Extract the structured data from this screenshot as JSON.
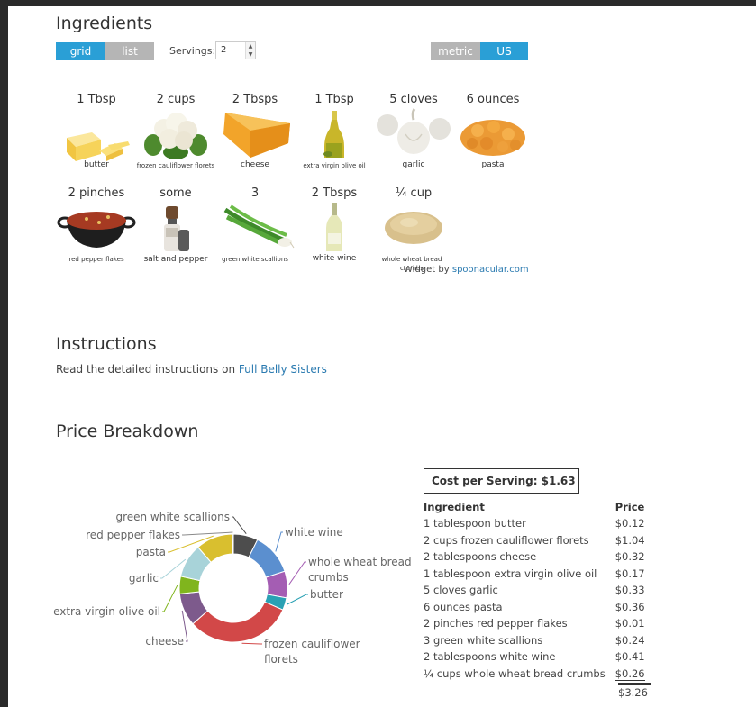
{
  "ingredients_section": {
    "title": "Ingredients",
    "view_toggle": {
      "grid": "grid",
      "list": "list",
      "active": "grid"
    },
    "servings_label": "Servings:",
    "servings_value": "2",
    "unit_toggle": {
      "metric": "metric",
      "us": "US",
      "active": "US"
    },
    "items": [
      {
        "amount": "1 Tbsp",
        "name": "butter",
        "icon": "butter"
      },
      {
        "amount": "2 cups",
        "name": "frozen cauliflower florets",
        "icon": "cauliflower"
      },
      {
        "amount": "2 Tbsps",
        "name": "cheese",
        "icon": "cheese"
      },
      {
        "amount": "1 Tbsp",
        "name": "extra virgin olive oil",
        "icon": "olive-oil"
      },
      {
        "amount": "5 cloves",
        "name": "garlic",
        "icon": "garlic"
      },
      {
        "amount": "6 ounces",
        "name": "pasta",
        "icon": "pasta"
      },
      {
        "amount": "2 pinches",
        "name": "red pepper flakes",
        "icon": "red-pepper-flakes"
      },
      {
        "amount": "some",
        "name": "salt and pepper",
        "icon": "salt-pepper"
      },
      {
        "amount": "3",
        "name": "green white scallions",
        "icon": "scallions"
      },
      {
        "amount": "2 Tbsps",
        "name": "white wine",
        "icon": "white-wine"
      },
      {
        "amount": "¼ cup",
        "name": "whole wheat bread crumbs",
        "icon": "bread-crumbs"
      }
    ],
    "widget_by": "Widget by",
    "widget_link": "spoonacular.com"
  },
  "instructions_section": {
    "title": "Instructions",
    "text": "Read the detailed instructions on",
    "link": "Full Belly Sisters"
  },
  "price_section": {
    "title": "Price Breakdown",
    "cost_per_serving": "Cost per Serving: $1.63",
    "table": {
      "header_ingredient": "Ingredient",
      "header_price": "Price",
      "rows": [
        {
          "ingredient": "1 tablespoon butter",
          "price": "$0.12"
        },
        {
          "ingredient": "2 cups frozen cauliflower florets",
          "price": "$1.04"
        },
        {
          "ingredient": "2 tablespoons cheese",
          "price": "$0.32"
        },
        {
          "ingredient": "1 tablespoon extra virgin olive oil",
          "price": "$0.17"
        },
        {
          "ingredient": "5 cloves garlic",
          "price": "$0.33"
        },
        {
          "ingredient": "6 ounces pasta",
          "price": "$0.36"
        },
        {
          "ingredient": "2 pinches red pepper flakes",
          "price": "$0.01"
        },
        {
          "ingredient": "3 green white scallions",
          "price": "$0.24"
        },
        {
          "ingredient": "2 tablespoons white wine",
          "price": "$0.41"
        },
        {
          "ingredient": "¼ cups whole wheat bread crumbs",
          "price": "$0.26"
        }
      ],
      "total": "$3.26"
    }
  },
  "chart_data": {
    "type": "pie",
    "donut": true,
    "slices": [
      {
        "label": "green white scallions",
        "value": 0.24,
        "color": "#4d4d4d"
      },
      {
        "label": "white wine",
        "value": 0.41,
        "color": "#5b8fcf"
      },
      {
        "label": "whole wheat bread crumbs",
        "value": 0.26,
        "color": "#a45db3"
      },
      {
        "label": "butter",
        "value": 0.12,
        "color": "#2aa1b4"
      },
      {
        "label": "frozen cauliflower florets",
        "value": 1.04,
        "color": "#d24848"
      },
      {
        "label": "cheese",
        "value": 0.32,
        "color": "#7d5a8c"
      },
      {
        "label": "extra virgin olive oil",
        "value": 0.17,
        "color": "#80b51d"
      },
      {
        "label": "garlic",
        "value": 0.33,
        "color": "#a8d3d9"
      },
      {
        "label": "pasta",
        "value": 0.36,
        "color": "#d9bf2f"
      },
      {
        "label": "red pepper flakes",
        "value": 0.01,
        "color": "#8a8a8a"
      }
    ]
  },
  "colors": {
    "accent": "#2a9fd6",
    "inactive": "#b5b5b5",
    "link": "#2a7ab0"
  }
}
